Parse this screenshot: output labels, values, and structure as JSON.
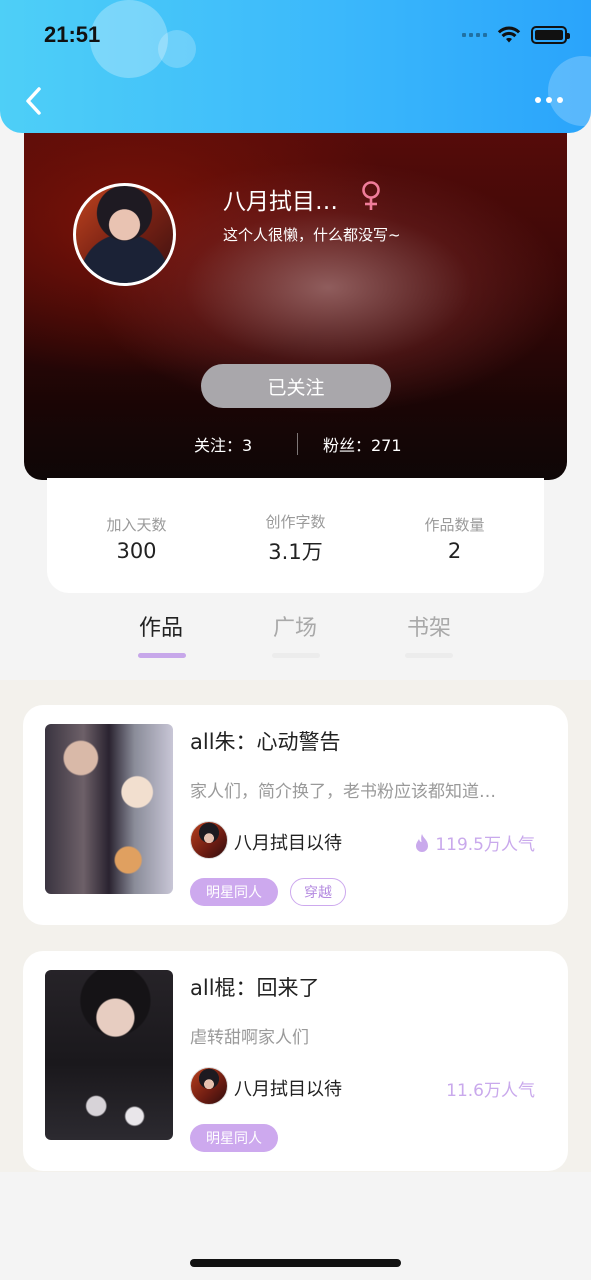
{
  "status_bar": {
    "time": "21:51"
  },
  "profile": {
    "nickname": "八月拭目…",
    "gender_symbol": "♀",
    "bio": "这个人很懒，什么都没写~",
    "follow_button": "已关注",
    "following_label": "关注：3",
    "fans_label": "粉丝：271"
  },
  "counts": [
    {
      "label": "加入天数",
      "value": "300"
    },
    {
      "label": "创作字数",
      "value": "3.1万"
    },
    {
      "label": "作品数量",
      "value": "2"
    }
  ],
  "tabs": [
    {
      "label": "作品",
      "active": true
    },
    {
      "label": "广场",
      "active": false
    },
    {
      "label": "书架",
      "active": false
    }
  ],
  "books": [
    {
      "title": "all朱：心动警告",
      "description": "家人们，简介换了，老书粉应该都知道…",
      "author": "八月拭目以待",
      "popularity": "119.5万人气",
      "tags": [
        "明星同人",
        "穿越"
      ]
    },
    {
      "title": "all棍：回来了",
      "description": "虐转甜啊家人们",
      "author": "八月拭目以待",
      "popularity": "11.6万人气",
      "tags": [
        "明星同人"
      ]
    }
  ],
  "colors": {
    "header_gradient_start": "#4ecff7",
    "header_gradient_end": "#2aa4fb",
    "accent_purple": "#cda9ee",
    "popularity_purple": "#c9a9ec",
    "follow_button_gray": "#a9a7ab"
  },
  "icons": {
    "back": "chevron-left-icon",
    "more": "more-dots-icon",
    "gender": "female-icon",
    "popularity": "flame-icon"
  }
}
